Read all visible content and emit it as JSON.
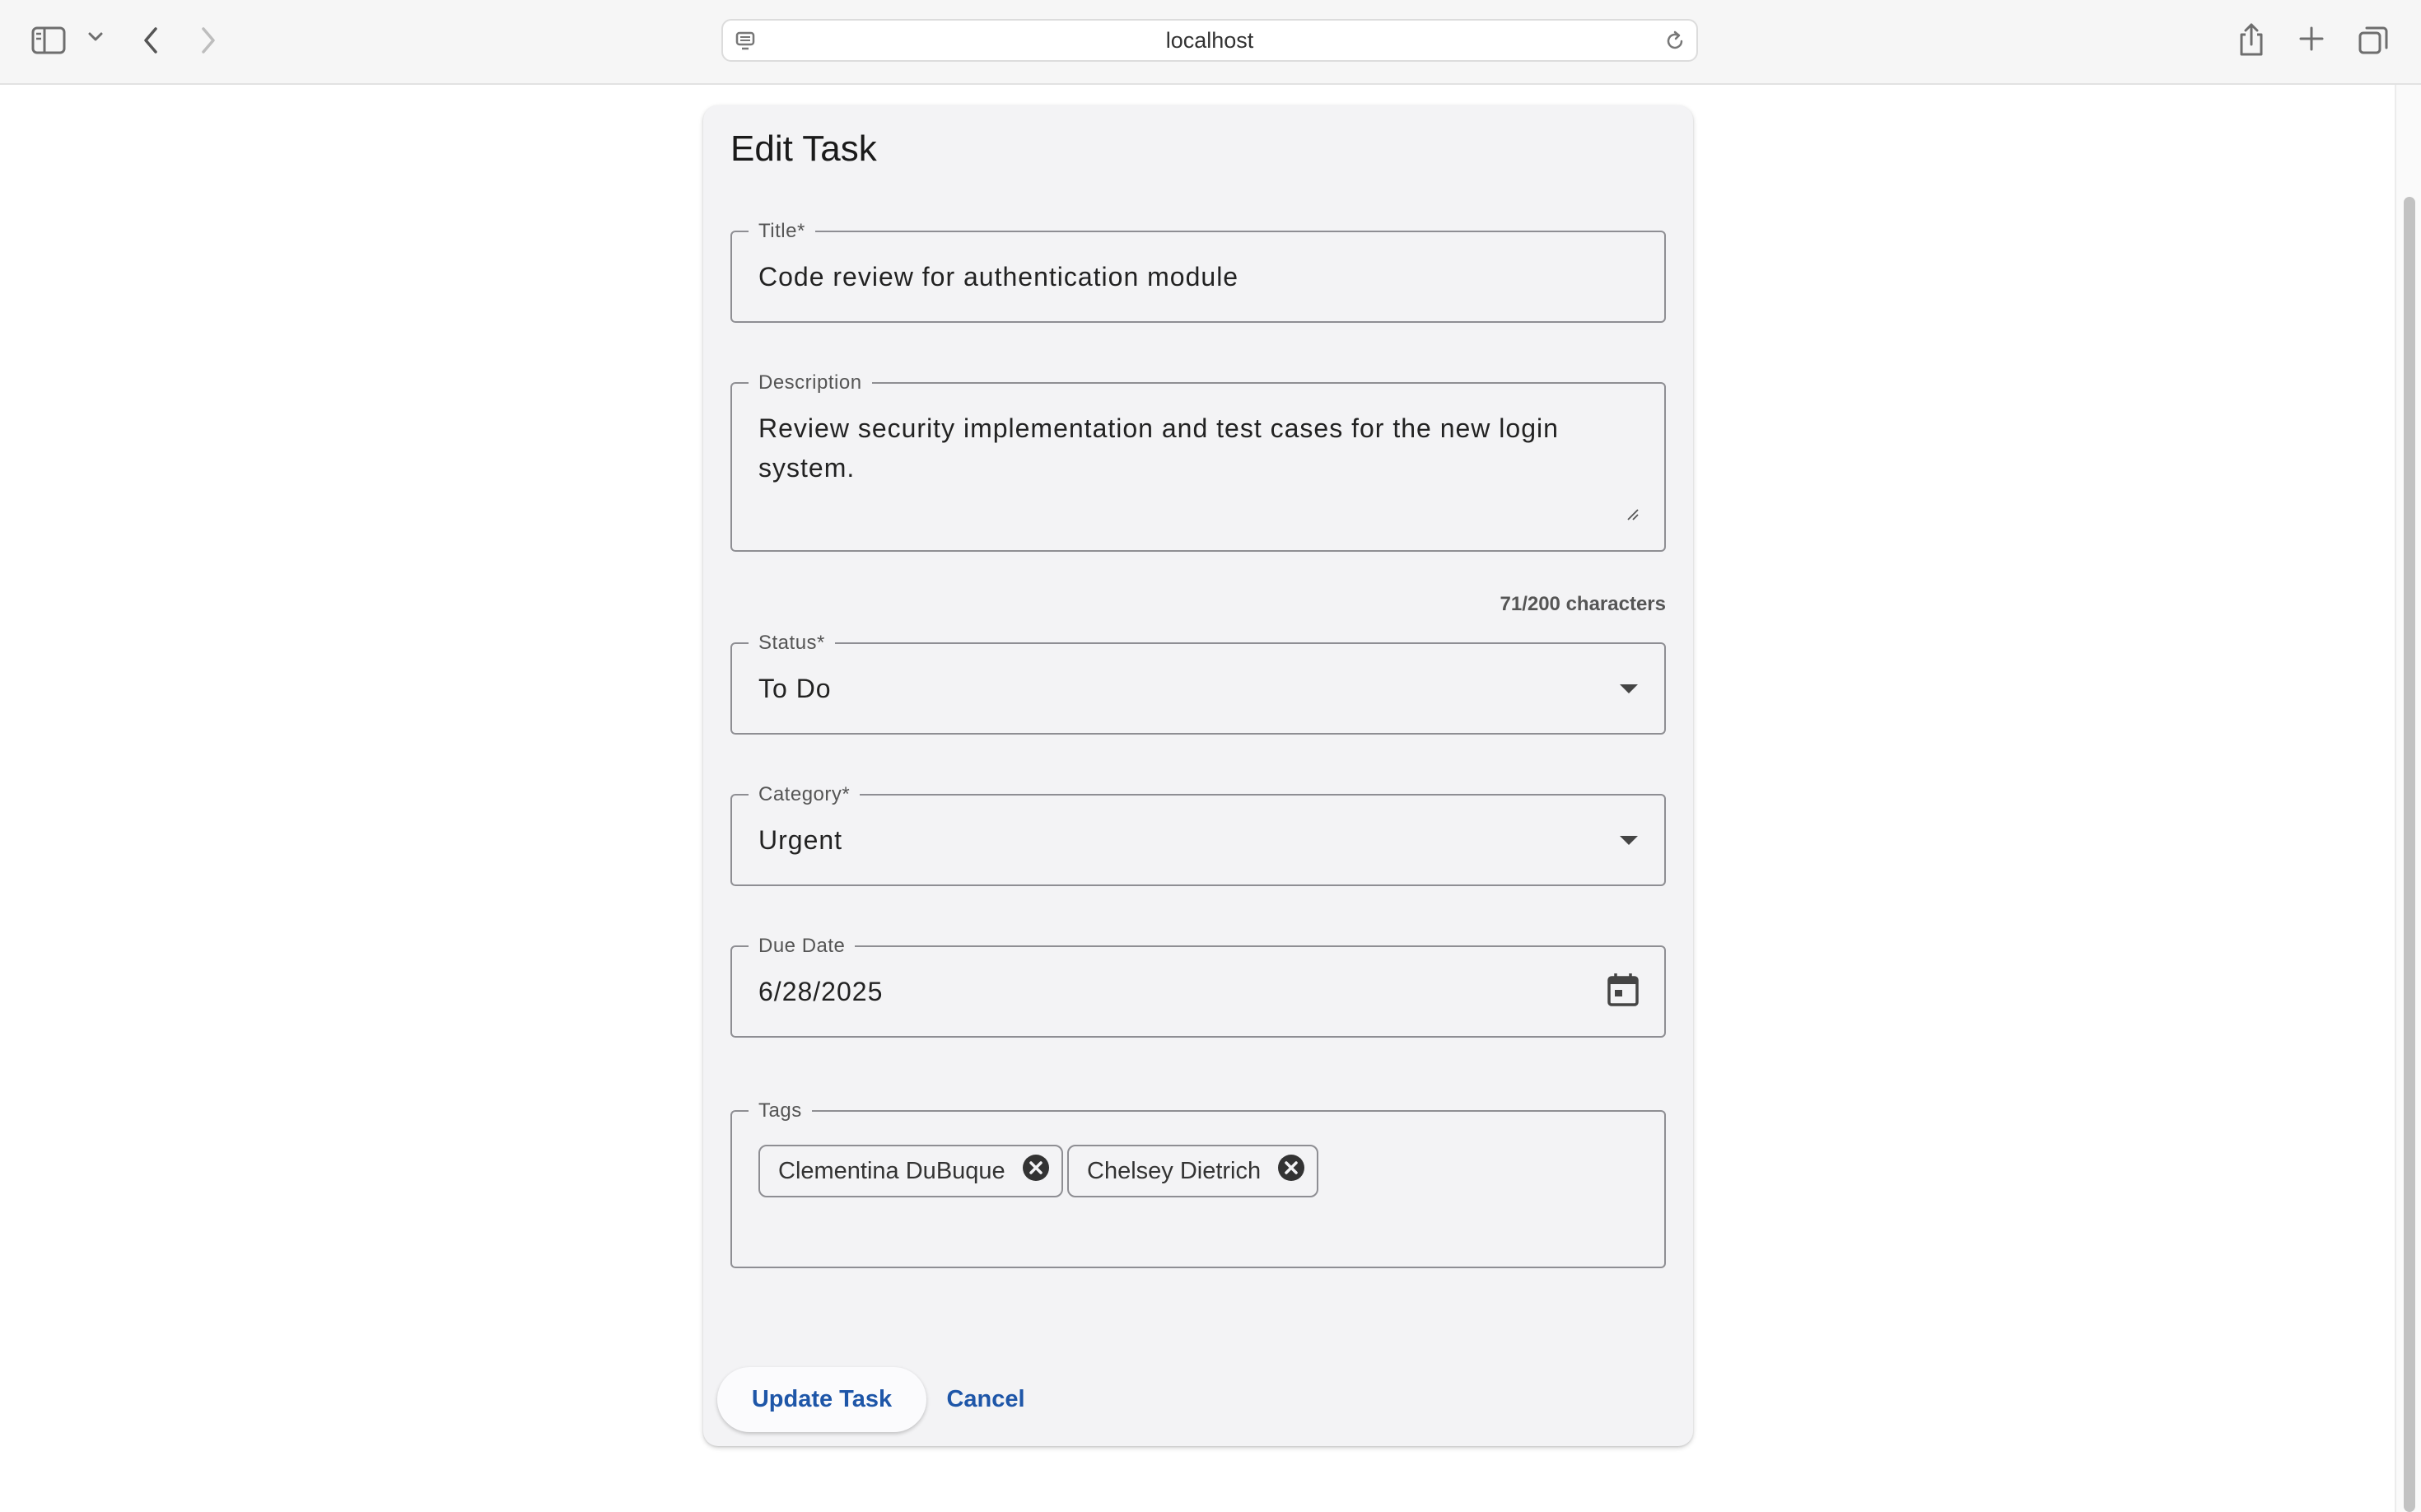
{
  "browser": {
    "url": "localhost",
    "icons": [
      "sidebar-icon",
      "chevron-down-icon",
      "back-icon",
      "forward-icon",
      "site-icon",
      "reload-icon",
      "share-icon",
      "plus-icon",
      "tabs-icon"
    ]
  },
  "form": {
    "heading": "Edit Task",
    "title": {
      "label": "Title*",
      "value": "Code review for authentication module"
    },
    "description": {
      "label": "Description",
      "value": "Review security implementation and test cases for the new login system.",
      "counter": "71/200 characters"
    },
    "status": {
      "label": "Status*",
      "value": "To Do"
    },
    "category": {
      "label": "Category*",
      "value": "Urgent"
    },
    "due_date": {
      "label": "Due Date",
      "value": "6/28/2025"
    },
    "tags": {
      "label": "Tags",
      "items": [
        {
          "label": "Clementina DuBuque"
        },
        {
          "label": "Chelsey Dietrich"
        }
      ]
    },
    "actions": {
      "submit": "Update Task",
      "cancel": "Cancel"
    }
  },
  "colors": {
    "accent": "#1e56a8",
    "card_bg": "#f3f3f5",
    "border": "#8e8e93"
  }
}
